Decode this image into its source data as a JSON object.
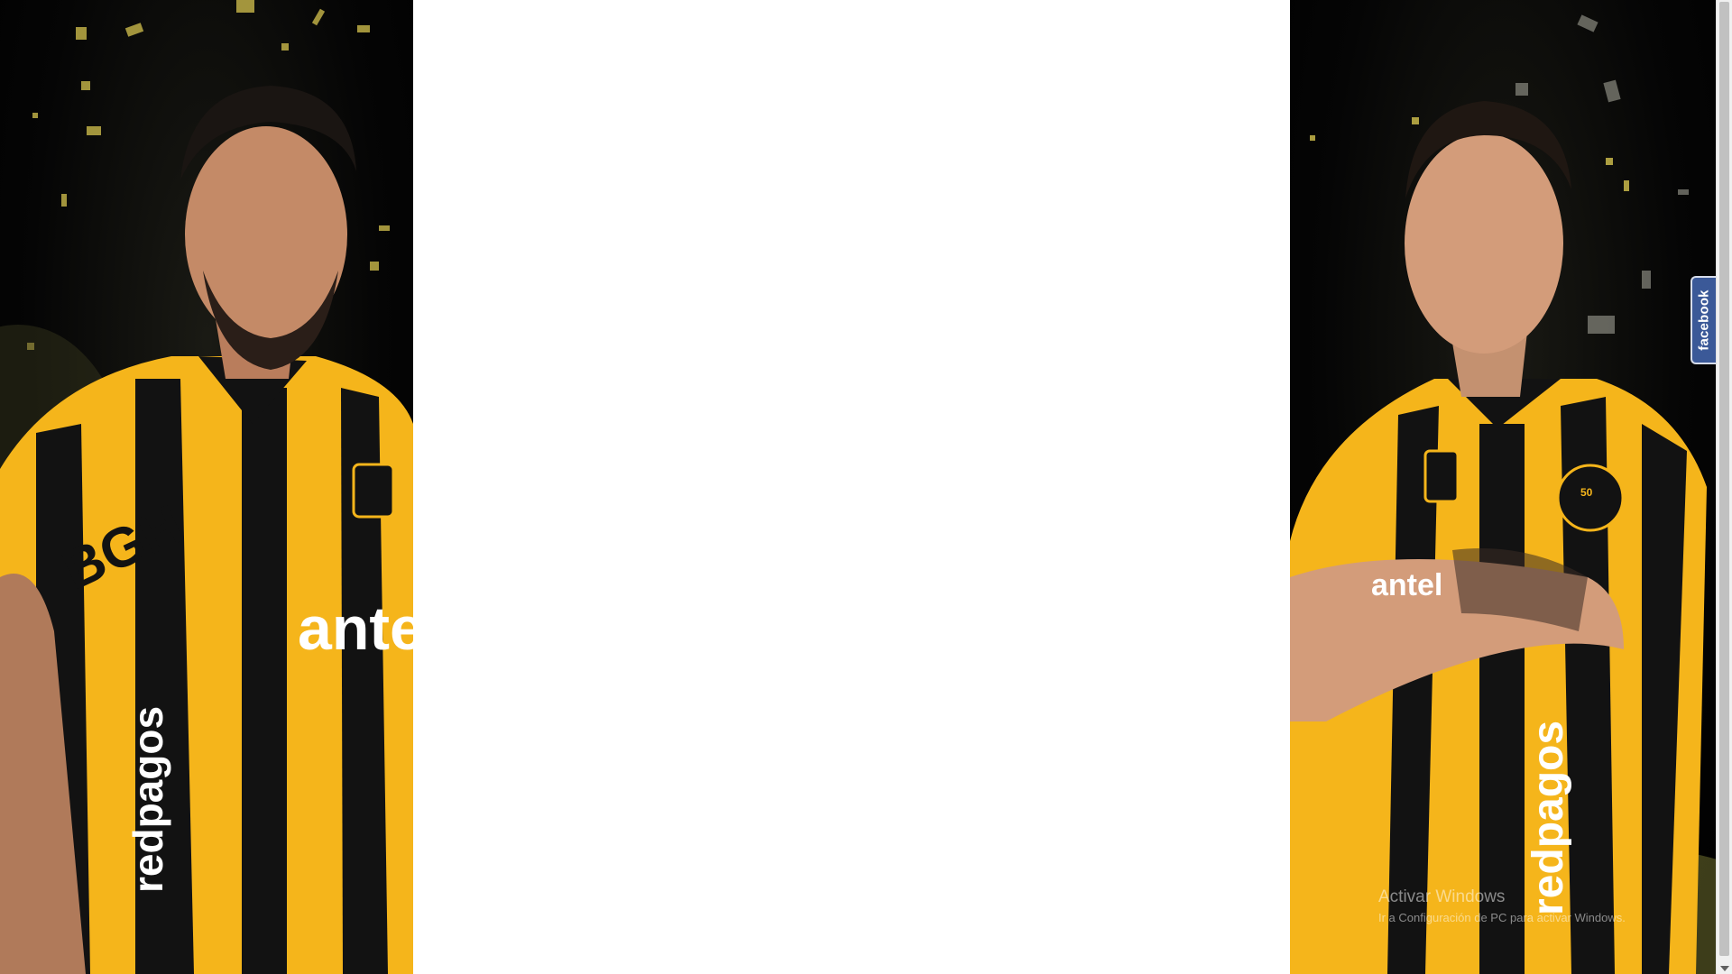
{
  "left_player": {
    "image_label": "player-left-photo",
    "jersey_texts": [
      "BGH",
      "antel",
      "redpagos"
    ]
  },
  "right_player": {
    "image_label": "player-right-photo",
    "jersey_texts": [
      "antel",
      "redpagos"
    ],
    "badge_number": "50"
  },
  "facebook_tab": {
    "label": "facebook"
  },
  "windows_watermark": {
    "title": "Activar Windows",
    "subtitle": "Ir a Configuración de PC para activar Windows."
  },
  "colors": {
    "jersey_yellow": "#f5b51b",
    "jersey_black": "#121212",
    "background": "#000000",
    "facebook_blue": "#3b5998"
  }
}
